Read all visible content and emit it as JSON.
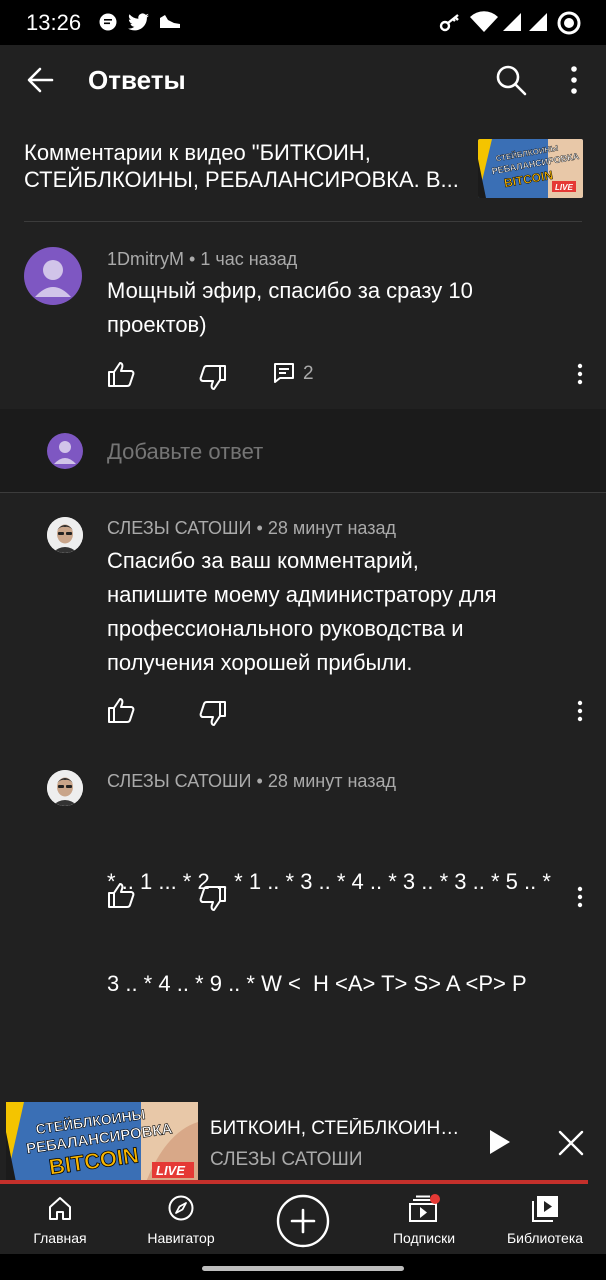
{
  "status_bar": {
    "time": "13:26"
  },
  "app_bar": {
    "title": "Ответы"
  },
  "video": {
    "title_line1": "Комментарии к видео \"БИТКОИН,",
    "title_line2": "СТЕЙБЛКОИНЫ, РЕБАЛАНСИРОВКА. В...",
    "thumb_text_1": "СТЕЙБЛКОИНЫ",
    "thumb_text_2": "РЕБАЛАНСИРОВКА",
    "thumb_text_3": "BITCOIN",
    "thumb_text_4": "LIVE"
  },
  "parent_comment": {
    "author": "1DmitryM",
    "separator": "•",
    "time": "1 час назад",
    "text_line1": "Мощный эфир, спасибо за сразу 10",
    "text_line2": "проектов)",
    "replies_count": "2"
  },
  "reply_input": {
    "placeholder": "Добавьте ответ"
  },
  "replies": [
    {
      "author": "СЛЕЗЫ САТОШИ",
      "separator": "•",
      "time": "28 минут назад",
      "text_line1": "Спасибо за ваш комментарий,",
      "text_line2": "напишите моему администратору для",
      "text_line3": "профессионального руководства и",
      "text_line4": "получения хорошей прибыли."
    },
    {
      "author": "СЛЕЗЫ САТОШИ",
      "separator": "•",
      "time": "28 минут назад",
      "text_line1": "* .. 1 ... * 2 .. * 1 .. * 3 .. * 4 .. * 3 .. * 3 .. * 5 .. *",
      "text_line2": "3 .. * 4 .. * 9 .. * W <  H <A> T> S> A <P> P"
    }
  ],
  "mini_player": {
    "title": "БИТКОИН, СТЕЙБЛКОИНЫ, РЕБАЛАНСИРОВКА",
    "channel": "СЛЕЗЫ САТОШИ",
    "progress": 0.97
  },
  "bottom_nav": {
    "home": "Главная",
    "explore": "Навигатор",
    "subscriptions": "Подписки",
    "library": "Библиотека"
  },
  "colors": {
    "background": "#212121",
    "accent_red": "#c4302b",
    "avatar_purple": "#7e57c2",
    "secondary_text": "#aaaaaa"
  }
}
